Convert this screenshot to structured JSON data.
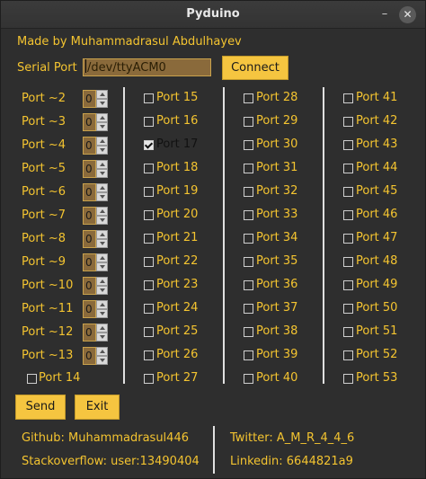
{
  "window": {
    "title": "Pyduino",
    "minimize_icon": "minimize-icon",
    "close_icon": "close-icon"
  },
  "author": "Made by Muhammadrasul Abdulhayev",
  "serial": {
    "label": "Serial Port",
    "value": "/dev/ttyACM0",
    "connect_label": "Connect"
  },
  "pwm_ports": [
    {
      "label": "Port ~2",
      "value": "0"
    },
    {
      "label": "Port ~3",
      "value": "0"
    },
    {
      "label": "Port ~4",
      "value": "0"
    },
    {
      "label": "Port ~5",
      "value": "0"
    },
    {
      "label": "Port ~6",
      "value": "0"
    },
    {
      "label": "Port ~7",
      "value": "0"
    },
    {
      "label": "Port ~8",
      "value": "0"
    },
    {
      "label": "Port ~9",
      "value": "0"
    },
    {
      "label": "Port ~10",
      "value": "0"
    },
    {
      "label": "Port ~11",
      "value": "0"
    },
    {
      "label": "Port ~12",
      "value": "0"
    },
    {
      "label": "Port ~13",
      "value": "0"
    }
  ],
  "port14": {
    "label": "Port 14",
    "checked": false
  },
  "digital_columns": [
    [
      {
        "label": "Port 15",
        "checked": false
      },
      {
        "label": "Port 16",
        "checked": false
      },
      {
        "label": "Port 17",
        "checked": true
      },
      {
        "label": "Port 18",
        "checked": false
      },
      {
        "label": "Port 19",
        "checked": false
      },
      {
        "label": "Port 20",
        "checked": false
      },
      {
        "label": "Port 21",
        "checked": false
      },
      {
        "label": "Port 22",
        "checked": false
      },
      {
        "label": "Port 23",
        "checked": false
      },
      {
        "label": "Port 24",
        "checked": false
      },
      {
        "label": "Port 25",
        "checked": false
      },
      {
        "label": "Port 26",
        "checked": false
      },
      {
        "label": "Port 27",
        "checked": false
      }
    ],
    [
      {
        "label": "Port 28",
        "checked": false
      },
      {
        "label": "Port 29",
        "checked": false
      },
      {
        "label": "Port 30",
        "checked": false
      },
      {
        "label": "Port 31",
        "checked": false
      },
      {
        "label": "Port 32",
        "checked": false
      },
      {
        "label": "Port 33",
        "checked": false
      },
      {
        "label": "Port 34",
        "checked": false
      },
      {
        "label": "Port 35",
        "checked": false
      },
      {
        "label": "Port 36",
        "checked": false
      },
      {
        "label": "Port 37",
        "checked": false
      },
      {
        "label": "Port 38",
        "checked": false
      },
      {
        "label": "Port 39",
        "checked": false
      },
      {
        "label": "Port 40",
        "checked": false
      }
    ],
    [
      {
        "label": "Port 41",
        "checked": false
      },
      {
        "label": "Port 42",
        "checked": false
      },
      {
        "label": "Port 43",
        "checked": false
      },
      {
        "label": "Port 44",
        "checked": false
      },
      {
        "label": "Port 45",
        "checked": false
      },
      {
        "label": "Port 46",
        "checked": false
      },
      {
        "label": "Port 47",
        "checked": false
      },
      {
        "label": "Port 48",
        "checked": false
      },
      {
        "label": "Port 49",
        "checked": false
      },
      {
        "label": "Port 50",
        "checked": false
      },
      {
        "label": "Port 51",
        "checked": false
      },
      {
        "label": "Port 52",
        "checked": false
      },
      {
        "label": "Port 53",
        "checked": false
      }
    ]
  ],
  "actions": {
    "send_label": "Send",
    "exit_label": "Exit"
  },
  "footer": {
    "github": "Github: Muhammadrasul446",
    "stackoverflow": "Stackoverflow: user:13490404",
    "twitter": "Twitter: A_M_R_4_4_6",
    "linkedin": "Linkedin: 6644821a9"
  },
  "colors": {
    "background": "#2e2e2e",
    "accent": "#f4c430",
    "button": "#f5c540",
    "input": "#8a6a3b"
  }
}
